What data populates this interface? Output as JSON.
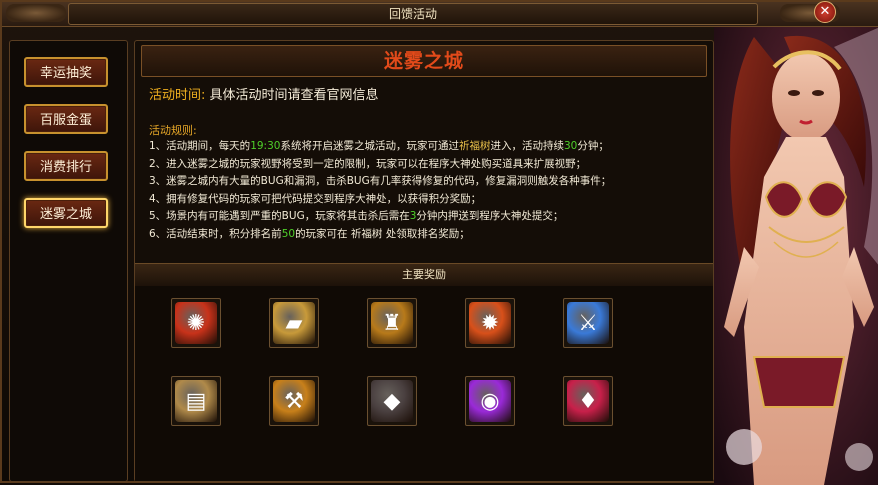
{
  "window": {
    "title": "回馈活动",
    "close_label": "✕"
  },
  "sidebar": {
    "items": [
      {
        "label": "幸运抽奖",
        "active": false
      },
      {
        "label": "百服金蛋",
        "active": false
      },
      {
        "label": "消费排行",
        "active": false
      },
      {
        "label": "迷雾之城",
        "active": true
      }
    ]
  },
  "event": {
    "title": "迷雾之城",
    "time_label": "活动时间:",
    "time_value": "具体活动时间请查看官网信息",
    "rules_label": "活动规则:",
    "rules": [
      {
        "parts": [
          {
            "t": "1、活动期间，每天的"
          },
          {
            "t": "19:30",
            "c": "hl"
          },
          {
            "t": "系统将开启迷雾之城活动，玩家可通过"
          },
          {
            "t": "祈福树",
            "c": "hl2"
          },
          {
            "t": "进入，活动持续"
          },
          {
            "t": "30",
            "c": "hl"
          },
          {
            "t": "分钟；"
          }
        ]
      },
      {
        "parts": [
          {
            "t": "2、进入迷雾之城的玩家视野将受到一定的限制，玩家可以在程序大神处购买道具来扩展视野；"
          }
        ]
      },
      {
        "parts": [
          {
            "t": "3、迷雾之城内有大量的BUG和漏洞，击杀BUG有几率获得修复的代码，修复漏洞则触发各种事件；"
          }
        ]
      },
      {
        "parts": [
          {
            "t": "4、拥有修复代码的玩家可把代码提交到程序大神处，以获得积分奖励；"
          }
        ]
      },
      {
        "parts": [
          {
            "t": "5、场景内有可能遇到严重的BUG，玩家将其击杀后需在"
          },
          {
            "t": "3",
            "c": "hl"
          },
          {
            "t": "分钟内押送到程序大神处提交；"
          }
        ]
      },
      {
        "parts": [
          {
            "t": "6、活动结束时，积分排名前"
          },
          {
            "t": "50",
            "c": "hl"
          },
          {
            "t": "的玩家可在 祈福树 处领取排名奖励；"
          }
        ]
      }
    ]
  },
  "rewards": {
    "title": "主要奖励",
    "items": [
      {
        "icon": "red-seal-orb-icon",
        "glyph": "✺",
        "color": "#c8321a"
      },
      {
        "icon": "gold-treasure-chest-icon",
        "glyph": "▰",
        "color": "#c89a3a"
      },
      {
        "icon": "golden-lion-shield-icon",
        "glyph": "♜",
        "color": "#b87a1a"
      },
      {
        "icon": "fire-rune-icon",
        "glyph": "✹",
        "color": "#d8501a"
      },
      {
        "icon": "ice-blue-sword-icon",
        "glyph": "⚔",
        "color": "#3a7ad8"
      },
      {
        "icon": "scroll-cards-icon",
        "glyph": "▤",
        "color": "#b08a4a"
      },
      {
        "icon": "golden-hammer-icon",
        "glyph": "⚒",
        "color": "#c8801a"
      },
      {
        "icon": "dark-crystal-shard-icon",
        "glyph": "◆",
        "color": "#4a4040"
      },
      {
        "icon": "purple-magic-orb-icon",
        "glyph": "◉",
        "color": "#9a2ad8"
      },
      {
        "icon": "gem-treasure-box-icon",
        "glyph": "♦",
        "color": "#c8204a"
      }
    ]
  }
}
